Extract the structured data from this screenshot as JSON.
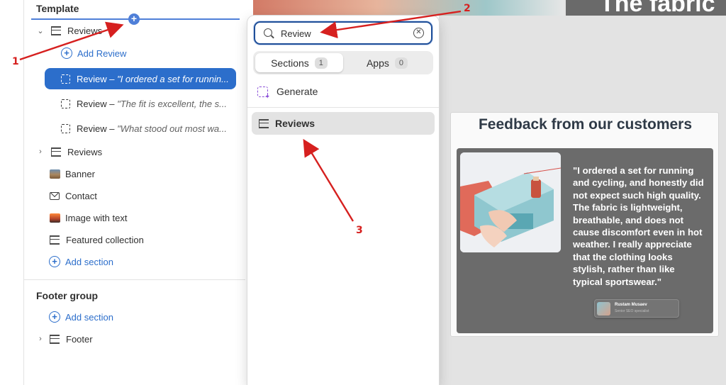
{
  "sidebar": {
    "template_label": "Template",
    "reviews_section_label": "Reviews",
    "add_review_label": "Add Review",
    "review_blocks": [
      {
        "prefix": "Review –",
        "quote": "\"I ordered a set for runnin..."
      },
      {
        "prefix": "Review –",
        "quote": "\"The fit is excellent, the s..."
      },
      {
        "prefix": "Review –",
        "quote": "\"What stood out most wa..."
      }
    ],
    "sections": [
      {
        "label": "Reviews",
        "icon": "section-icon"
      },
      {
        "label": "Banner",
        "icon": "image-icon"
      },
      {
        "label": "Contact",
        "icon": "mail-icon"
      },
      {
        "label": "Image with text",
        "icon": "image-icon"
      },
      {
        "label": "Featured collection",
        "icon": "section-icon"
      }
    ],
    "add_section_label": "Add section",
    "footer_group_label": "Footer group",
    "footer_add_section_label": "Add section",
    "footer_label": "Footer"
  },
  "popover": {
    "search_value": "Review",
    "tabs": [
      {
        "label": "Sections",
        "count": "1"
      },
      {
        "label": "Apps",
        "count": "0"
      }
    ],
    "generate_label": "Generate",
    "result_label": "Reviews"
  },
  "preview": {
    "hero_title": "The fabric",
    "card_title": "Feedback from our customers",
    "quote": "\"I ordered a set for running and cycling, and honestly did not expect such high quality. The fabric is lightweight, breathable, and does not cause discomfort even in hot weather. I really appreciate that the clothing looks stylish, rather than like typical sportswear.\"",
    "author_name": "Rustam Musaev",
    "author_role": "Senior SEO specialist"
  },
  "annotations": {
    "labels": [
      "1",
      "2",
      "3"
    ],
    "color": "#d6201f"
  },
  "colors": {
    "accent": "#2c6ecb",
    "selected": "#2c6ecb",
    "insert_line": "#4f7fd8"
  }
}
